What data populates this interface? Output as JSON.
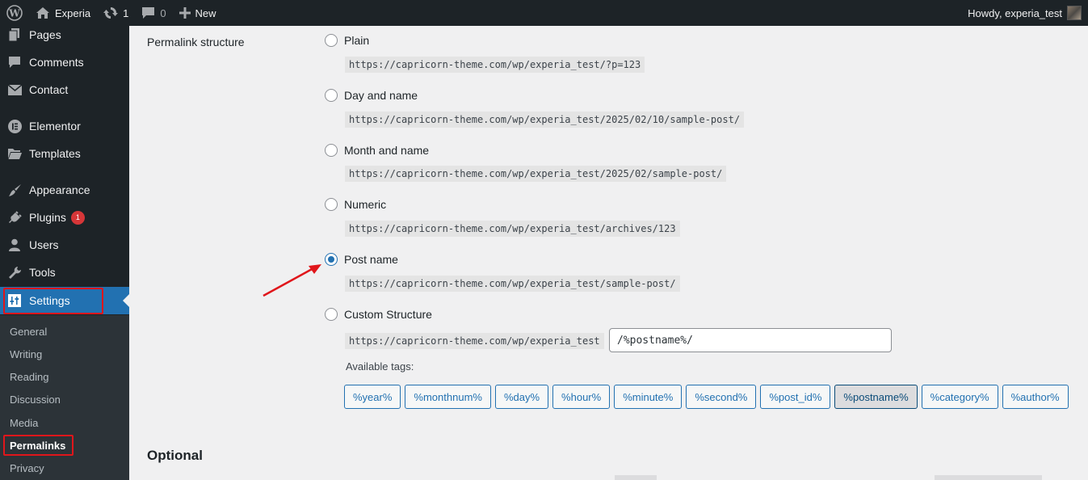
{
  "adminbar": {
    "site_name": "Experia",
    "updates_count": "1",
    "comments_count": "0",
    "new_label": "New",
    "howdy": "Howdy, experia_test"
  },
  "sidebar": {
    "items": [
      {
        "label": "Pages",
        "icon": "pages-icon"
      },
      {
        "label": "Comments",
        "icon": "comments-icon"
      },
      {
        "label": "Contact",
        "icon": "envelope-icon"
      },
      {
        "label": "Elementor",
        "icon": "elementor-icon"
      },
      {
        "label": "Templates",
        "icon": "folder-icon"
      },
      {
        "label": "Appearance",
        "icon": "paintbrush-icon"
      },
      {
        "label": "Plugins",
        "icon": "plugin-icon",
        "badge": "1"
      },
      {
        "label": "Users",
        "icon": "user-icon"
      },
      {
        "label": "Tools",
        "icon": "wrench-icon"
      },
      {
        "label": "Settings",
        "icon": "settings-icon"
      }
    ],
    "submenu": [
      "General",
      "Writing",
      "Reading",
      "Discussion",
      "Media",
      "Permalinks",
      "Privacy"
    ]
  },
  "permalinks": {
    "row_label": "Permalink structure",
    "options": [
      {
        "label": "Plain",
        "example": "https://capricorn-theme.com/wp/experia_test/?p=123",
        "checked": false
      },
      {
        "label": "Day and name",
        "example": "https://capricorn-theme.com/wp/experia_test/2025/02/10/sample-post/",
        "checked": false
      },
      {
        "label": "Month and name",
        "example": "https://capricorn-theme.com/wp/experia_test/2025/02/sample-post/",
        "checked": false
      },
      {
        "label": "Numeric",
        "example": "https://capricorn-theme.com/wp/experia_test/archives/123",
        "checked": false
      },
      {
        "label": "Post name",
        "example": "https://capricorn-theme.com/wp/experia_test/sample-post/",
        "checked": true
      },
      {
        "label": "Custom Structure",
        "example": "https://capricorn-theme.com/wp/experia_test",
        "checked": false
      }
    ],
    "custom_value": "/%postname%/",
    "available_tags_label": "Available tags:",
    "tags": [
      "%year%",
      "%monthnum%",
      "%day%",
      "%hour%",
      "%minute%",
      "%second%",
      "%post_id%",
      "%postname%",
      "%category%",
      "%author%"
    ],
    "active_tag": "%postname%"
  },
  "optional_heading": "Optional",
  "colors": {
    "accent": "#2271b1",
    "admin_dark": "#1d2327",
    "highlight_red": "#e0161b"
  }
}
